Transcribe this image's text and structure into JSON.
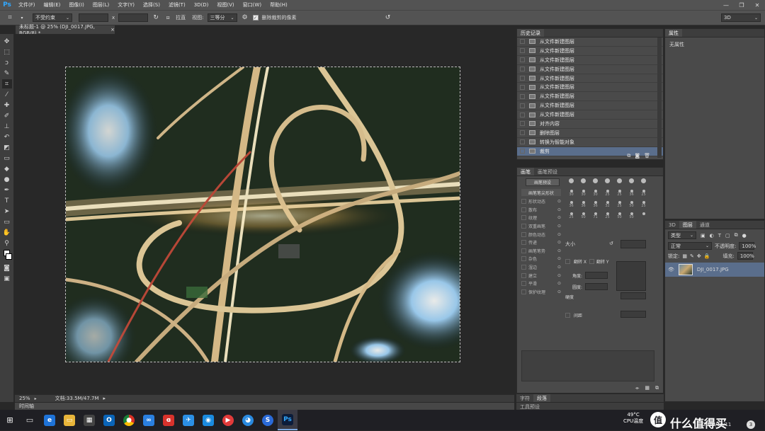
{
  "app": {
    "logo": "Ps"
  },
  "menu": [
    "文件(F)",
    "编辑(E)",
    "图像(I)",
    "图层(L)",
    "文字(Y)",
    "选择(S)",
    "滤镜(T)",
    "3D(D)",
    "视图(V)",
    "窗口(W)",
    "帮助(H)"
  ],
  "options": {
    "ratio_value": "不受约束",
    "swap": "x",
    "straighten_label": "拉直",
    "view_label": "视图:",
    "view_value": "三等分",
    "delete_cropped_label": "删除裁剪的像素",
    "workspace_value": "3D"
  },
  "document": {
    "tab_title": "未标题-1 @ 25% (DJI_0017.JPG, RGB/8) *",
    "close": "×"
  },
  "status": {
    "zoom": "25%",
    "doc_size": "文档:33.5M/47.7M"
  },
  "timeline": {
    "label": "时间轴"
  },
  "history": {
    "tabs": [
      "历史记录"
    ],
    "items": [
      "从文件新建图层",
      "从文件新建图层",
      "从文件新建图层",
      "从文件新建图层",
      "从文件新建图层",
      "从文件新建图层",
      "从文件新建图层",
      "从文件新建图层",
      "从文件新建图层",
      "对齐内容",
      "删除图层",
      "转换为智能对象",
      "裁剪"
    ],
    "selected_index": 12
  },
  "properties": {
    "tab": "属性",
    "empty_text": "无属性"
  },
  "brush": {
    "tabs": [
      "画笔",
      "画笔预设"
    ],
    "preset_button": "画笔预设",
    "tip_shape": "画笔笔尖形状",
    "options": [
      "形状动态",
      "散布",
      "纹理",
      "双重画笔",
      "颜色动态",
      "传递",
      "画笔笔势",
      "杂色",
      "湿边",
      "建立",
      "平滑",
      "保护纹理"
    ],
    "size_label": "大小",
    "flip_x": "翻转 X",
    "flip_y": "翻转 Y",
    "angle_label": "角度:",
    "roundness_label": "圆度:",
    "hardness_label": "硬度",
    "spacing_label": "间距",
    "sizes": [
      "30",
      "30",
      "30",
      "25",
      "25",
      "36",
      "25",
      "36",
      "36",
      "36",
      "32",
      "25",
      "50",
      "25",
      "25",
      "50",
      "71",
      "25",
      "50",
      "50"
    ]
  },
  "bottom_tabs": {
    "row1": [
      "字符",
      "段落"
    ],
    "row2": [
      "工具预设"
    ]
  },
  "layers": {
    "tabs": [
      "3D",
      "图层",
      "通道"
    ],
    "filter_kind": "类型",
    "blend_mode": "正常",
    "opacity_label": "不透明度:",
    "opacity_value": "100%",
    "lock_label": "锁定:",
    "fill_label": "填充:",
    "fill_value": "100%",
    "layer_name": "DJI_0017.JPG"
  },
  "taskbar": {
    "cpu_temp": "49°C",
    "cpu_label": "CPU温度",
    "date": "2016/10/11",
    "watermark_text": "什么值得买",
    "badge": "3"
  }
}
